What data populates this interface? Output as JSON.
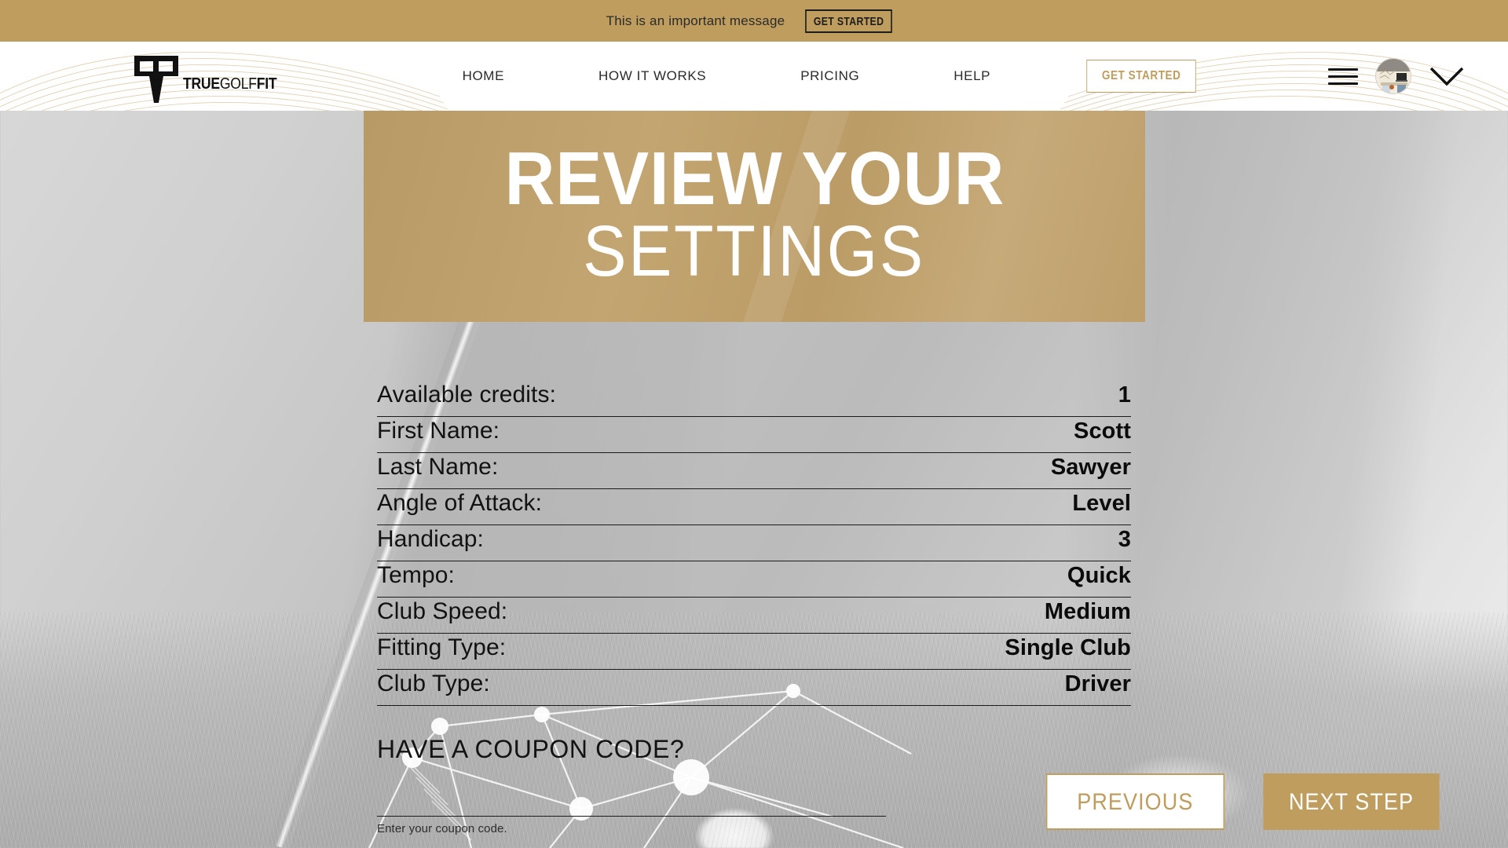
{
  "announcement": {
    "message": "This is an important message",
    "cta_label": "GET STARTED"
  },
  "navbar": {
    "logo": {
      "icon": "golf-tee-icon",
      "text_true": "TRUE",
      "text_golf": "GOLF",
      "text_fit": "FIT",
      "full_text": "TRUEGOLFFIT"
    },
    "links": [
      {
        "label": "HOME"
      },
      {
        "label": "HOW IT WORKS"
      },
      {
        "label": "PRICING"
      },
      {
        "label": "HELP"
      }
    ],
    "cta_label": "GET STARTED",
    "menu_icon": "hamburger-icon",
    "avatar_icon": "user-avatar",
    "chevron_icon": "chevron-down-icon"
  },
  "hero": {
    "line1": "REVIEW YOUR",
    "line2": "SETTINGS"
  },
  "settings": {
    "rows": [
      {
        "label": "Available credits:",
        "value": "1"
      },
      {
        "label": "First Name:",
        "value": "Scott"
      },
      {
        "label": "Last Name:",
        "value": "Sawyer"
      },
      {
        "label": "Angle of Attack:",
        "value": "Level"
      },
      {
        "label": "Handicap:",
        "value": "3"
      },
      {
        "label": "Tempo:",
        "value": "Quick"
      },
      {
        "label": "Club Speed:",
        "value": "Medium"
      },
      {
        "label": "Fitting Type:",
        "value": "Single Club"
      },
      {
        "label": "Club Type:",
        "value": "Driver"
      }
    ]
  },
  "coupon": {
    "title": "HAVE A COUPON CODE?",
    "input_value": "",
    "input_placeholder": "",
    "hint": "Enter your coupon code."
  },
  "actions": {
    "previous_label": "PREVIOUS",
    "next_label": "NEXT STEP"
  },
  "colors": {
    "gold": "#bf9d5e",
    "gold_hero": "#bb9c66",
    "text_dark": "#121212",
    "white": "#ffffff"
  }
}
